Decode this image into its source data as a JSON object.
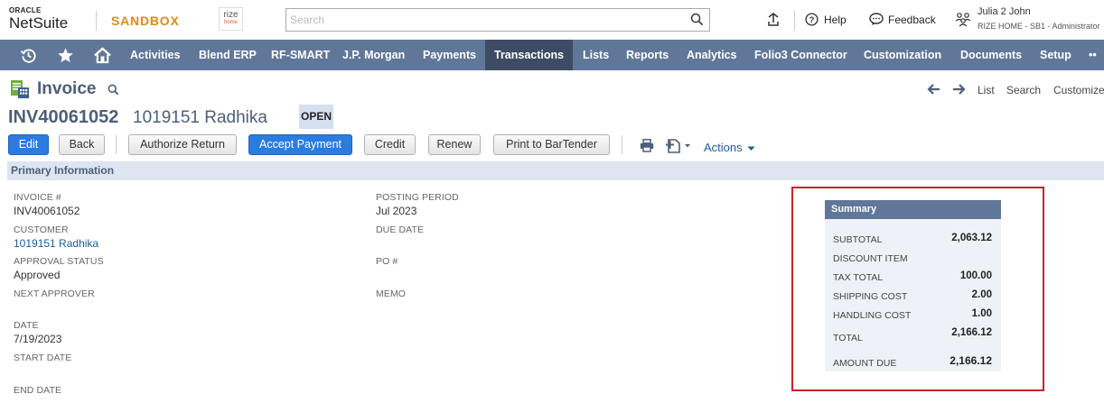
{
  "header": {
    "logo_top": "ORACLE",
    "logo_bottom": "NetSuite",
    "environment": "SANDBOX",
    "company_logo_top": "rize",
    "company_logo_bottom": "home",
    "search_placeholder": "Search",
    "help_label": "Help",
    "feedback_label": "Feedback",
    "user_name": "Julia 2 John",
    "user_role": "RIZE HOME - SB1 - Administrator"
  },
  "nav": {
    "items": [
      "Activities",
      "Blend ERP",
      "RF-SMART",
      "J.P. Morgan",
      "Payments",
      "Transactions",
      "Lists",
      "Reports",
      "Analytics",
      "Folio3 Connector",
      "Customization",
      "Documents",
      "Setup"
    ],
    "active": "Transactions",
    "more": "••"
  },
  "page": {
    "title": "Invoice",
    "record_number": "INV40061052",
    "record_name": "1019151 Radhika",
    "status": "OPEN",
    "list_link": "List",
    "search_link": "Search",
    "customize_link": "Customize"
  },
  "toolbar": {
    "edit": "Edit",
    "back": "Back",
    "authorize_return": "Authorize Return",
    "accept_payment": "Accept Payment",
    "credit": "Credit",
    "renew": "Renew",
    "print_bartender": "Print to BarTender",
    "actions": "Actions"
  },
  "primary": {
    "section_title": "Primary Information",
    "invoice_label": "INVOICE #",
    "invoice_value": "INV40061052",
    "customer_label": "CUSTOMER",
    "customer_value": "1019151 Radhika",
    "approval_label": "APPROVAL STATUS",
    "approval_value": "Approved",
    "next_approver_label": "NEXT APPROVER",
    "date_label": "DATE",
    "date_value": "7/19/2023",
    "start_date_label": "START DATE",
    "end_date_label": "END DATE",
    "posting_period_label": "POSTING PERIOD",
    "posting_period_value": "Jul 2023",
    "due_date_label": "DUE DATE",
    "po_label": "PO #",
    "memo_label": "MEMO"
  },
  "summary": {
    "title": "Summary",
    "subtotal_label": "SUBTOTAL",
    "subtotal_value": "2,063.12",
    "discount_label": "DISCOUNT ITEM",
    "tax_label": "TAX TOTAL",
    "tax_value": "100.00",
    "shipping_label": "SHIPPING COST",
    "shipping_value": "2.00",
    "handling_label": "HANDLING COST",
    "handling_value": "1.00",
    "total_label": "TOTAL",
    "total_value": "2,166.12",
    "amount_due_label": "AMOUNT DUE",
    "amount_due_value": "2,166.12"
  },
  "colors": {
    "nav_bg": "#607799",
    "nav_active": "#3d4c64",
    "primary_button": "#2b7ce0",
    "title_text": "#4d5f79",
    "sandbox": "#e08a16",
    "highlight_box": "#c8232c"
  }
}
